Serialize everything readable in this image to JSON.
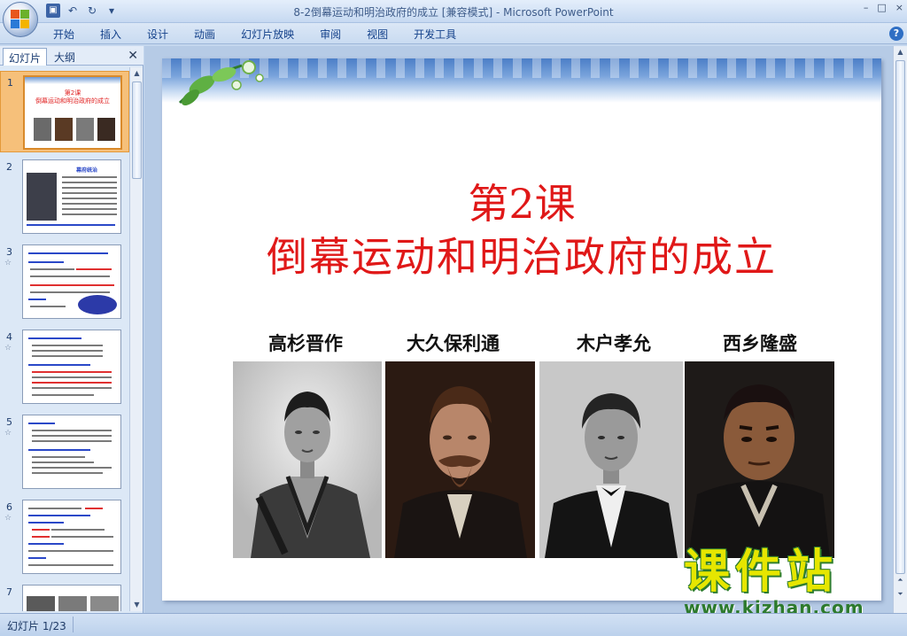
{
  "window": {
    "title": "8-2倒幕运动和明治政府的成立 [兼容模式] - Microsoft PowerPoint",
    "controls": [
      "–",
      "□",
      "×"
    ]
  },
  "quick_access": {
    "icons": [
      "save-icon",
      "undo-icon",
      "redo-icon",
      "customize-icon"
    ]
  },
  "ribbon": {
    "tabs": [
      "开始",
      "插入",
      "设计",
      "动画",
      "幻灯片放映",
      "审阅",
      "视图",
      "开发工具"
    ],
    "help": "?"
  },
  "left_pane": {
    "tabs": [
      "幻灯片",
      "大纲"
    ],
    "close": "✕",
    "slides": [
      {
        "num": "1",
        "selected": true
      },
      {
        "num": "2",
        "selected": false
      },
      {
        "num": "3",
        "selected": false
      },
      {
        "num": "4",
        "selected": false
      },
      {
        "num": "5",
        "selected": false
      },
      {
        "num": "6",
        "selected": false
      },
      {
        "num": "7",
        "selected": false
      }
    ],
    "thumb1": {
      "line1": "第2课",
      "line2": "倒幕运动和明治政府的成立"
    },
    "thumb2": {
      "heading": "幕府统治"
    }
  },
  "slide": {
    "title1": "第2课",
    "title2": "倒幕运动和明治政府的成立",
    "names": [
      "高杉晋作",
      "大久保利通",
      "木户孝允",
      "西乡隆盛"
    ]
  },
  "watermark": {
    "big": "课件站",
    "url": "www.kjzhan.com"
  },
  "status": {
    "slide_indicator": "幻灯片 1/23"
  },
  "colors": {
    "title_red": "#e01818",
    "ribbon_text": "#15428b",
    "selected_thumb": "#f6c07a"
  }
}
